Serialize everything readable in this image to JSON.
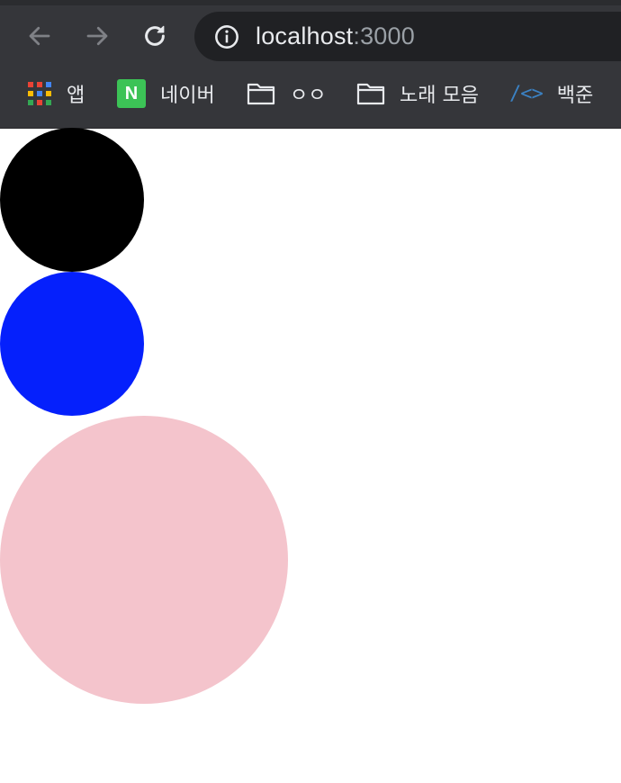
{
  "address_bar": {
    "host": "localhost",
    "port": ":3000"
  },
  "bookmarks": [
    {
      "label": "앱",
      "icon": "apps-grid-icon"
    },
    {
      "label": "네이버",
      "icon": "naver-icon",
      "icon_letter": "N"
    },
    {
      "label": "ㅇㅇ",
      "icon": "folder-icon"
    },
    {
      "label": "노래 모음",
      "icon": "folder-icon"
    },
    {
      "label": "백준",
      "icon": "code-brackets-icon",
      "icon_text": "/<>"
    }
  ],
  "circles": [
    {
      "color": "#000000"
    },
    {
      "color": "#0520fc"
    },
    {
      "color": "#f4c4cc"
    }
  ]
}
